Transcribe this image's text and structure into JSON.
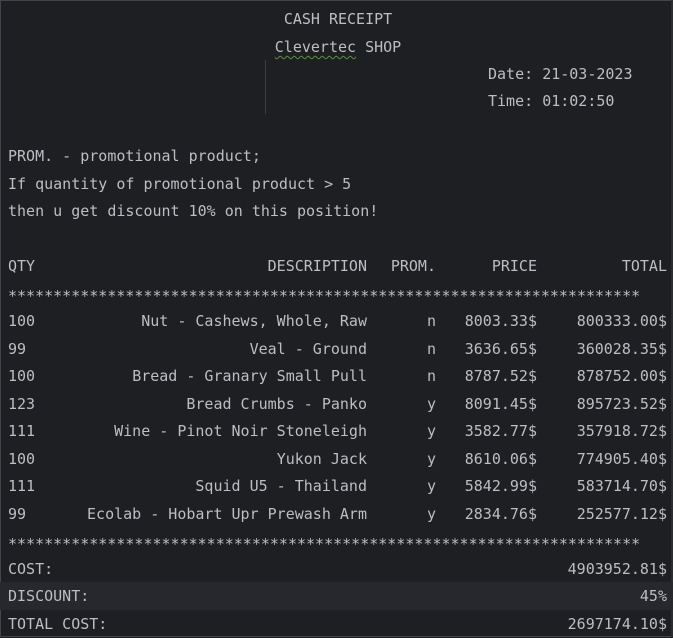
{
  "header": {
    "title": "CASH RECEIPT",
    "shop": "Clevertec",
    "shop_suffix": " SHOP",
    "date_label": "Date:",
    "date_value": "21-03-2023",
    "time_label": "Time:",
    "time_value": "01:02:50"
  },
  "notes": [
    "PROM. - promotional product;",
    "If quantity of promotional product > 5",
    "then u get discount 10% on this position!"
  ],
  "table": {
    "headers": {
      "qty": "QTY",
      "description": "DESCRIPTION",
      "prom": "PROM.",
      "price": "PRICE",
      "total": "TOTAL"
    },
    "separator": "**********************************************************************",
    "rows": [
      {
        "qty": "100",
        "description": "Nut - Cashews, Whole, Raw",
        "prom": "n",
        "price": "8003.33$",
        "total": "800333.00$"
      },
      {
        "qty": "99",
        "description": "Veal - Ground",
        "prom": "n",
        "price": "3636.65$",
        "total": "360028.35$"
      },
      {
        "qty": "100",
        "description": "Bread - Granary Small Pull",
        "prom": "n",
        "price": "8787.52$",
        "total": "878752.00$"
      },
      {
        "qty": "123",
        "description": "Bread Crumbs - Panko",
        "prom": "y",
        "price": "8091.45$",
        "total": "895723.52$"
      },
      {
        "qty": "111",
        "description": "Wine - Pinot Noir Stoneleigh",
        "prom": "y",
        "price": "3582.77$",
        "total": "357918.72$"
      },
      {
        "qty": "100",
        "description": "Yukon Jack",
        "prom": "y",
        "price": "8610.06$",
        "total": "774905.40$"
      },
      {
        "qty": "111",
        "description": "Squid U5 - Thailand",
        "prom": "y",
        "price": "5842.99$",
        "total": "583714.70$"
      },
      {
        "qty": "99",
        "description": "Ecolab - Hobart Upr Prewash Arm",
        "prom": "y",
        "price": "2834.76$",
        "total": "252577.12$"
      }
    ]
  },
  "summary": {
    "cost_label": "COST:",
    "cost_value": "4903952.81$",
    "discount_label": "DISCOUNT:",
    "discount_value": "45%",
    "total_label": "TOTAL COST:",
    "total_value": "2697174.10$"
  },
  "colors": {
    "background": "#1e1f22",
    "text": "#bcbec4",
    "squiggle": "#5a8f46"
  }
}
